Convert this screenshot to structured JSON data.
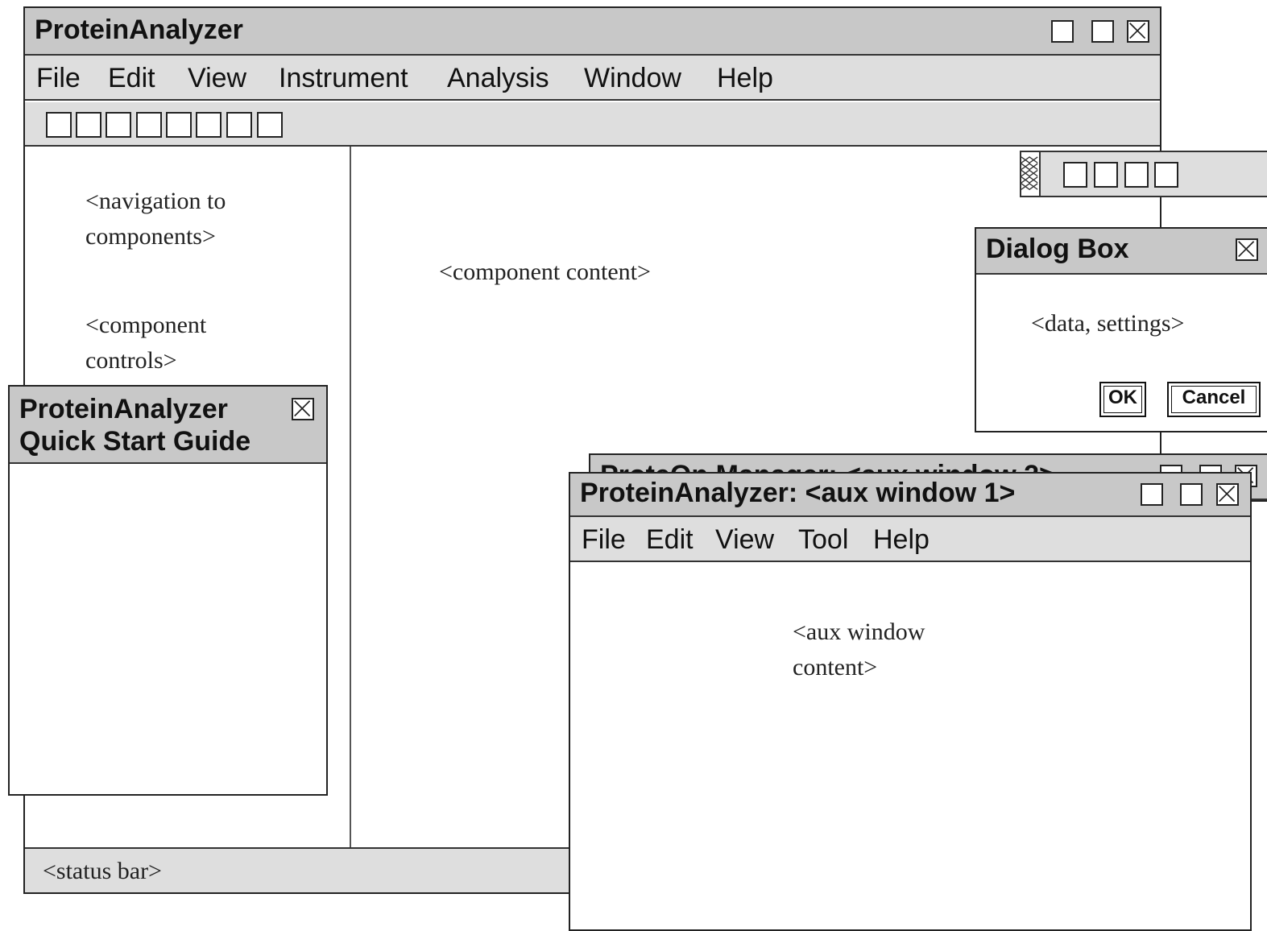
{
  "main_window": {
    "title": "ProteinAnalyzer",
    "menu": [
      "File",
      "Edit",
      "View",
      "Instrument",
      "Analysis",
      "Window",
      "Help"
    ],
    "nav_text": "<navigation to components>",
    "controls_text": "<component controls>",
    "content_text": "<component content>",
    "status_text": "<status bar>"
  },
  "quick_start": {
    "title": "ProteinAnalyzer Quick Start Guide"
  },
  "dialog": {
    "title": "Dialog Box",
    "body_text": "<data, settings>",
    "ok_label": "OK",
    "cancel_label": "Cancel"
  },
  "aux2": {
    "title": "ProteOn Manager: <aux window 2>"
  },
  "aux1": {
    "title": "ProteinAnalyzer: <aux window 1>",
    "menu": [
      "File",
      "Edit",
      "View",
      "Tool",
      "Help"
    ],
    "content_text": "<aux window content>"
  }
}
